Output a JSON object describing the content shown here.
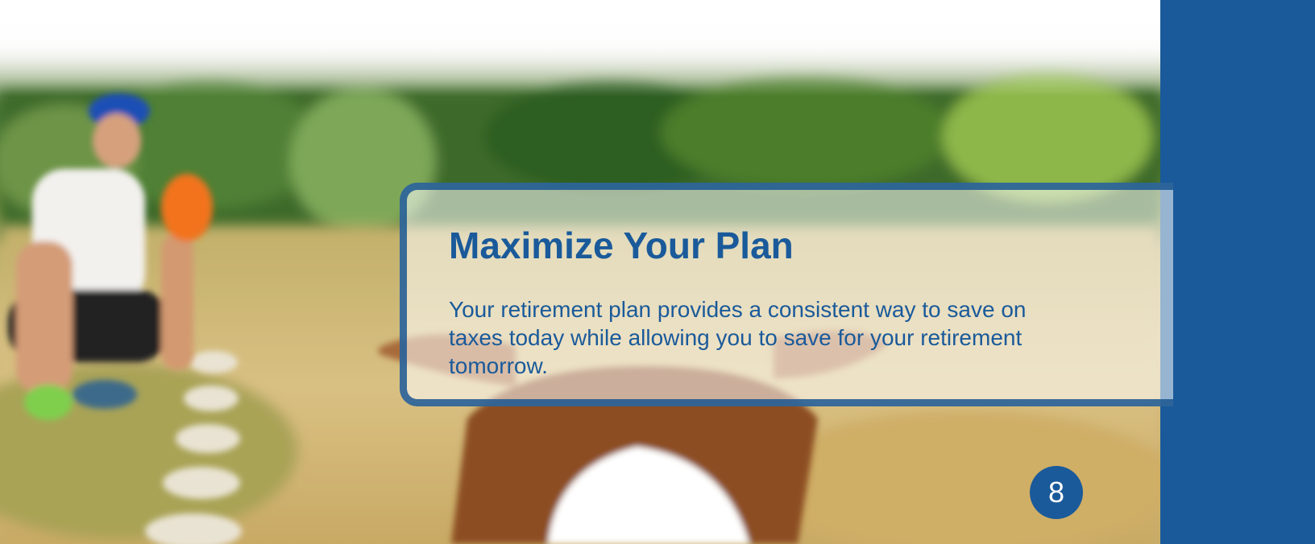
{
  "slide": {
    "title": "Maximize Your Plan",
    "body": "Your retirement plan provides a consistent way to save on taxes today while allowing you to save for your retirement tomorrow.",
    "page_number": "8"
  },
  "colors": {
    "brand_blue": "#1a5a9a",
    "card_border": "#1a5691",
    "text": "#1a5a9a"
  },
  "background_image": {
    "subject": "dog-facing-person-with-frisbee-in-field-photo"
  }
}
